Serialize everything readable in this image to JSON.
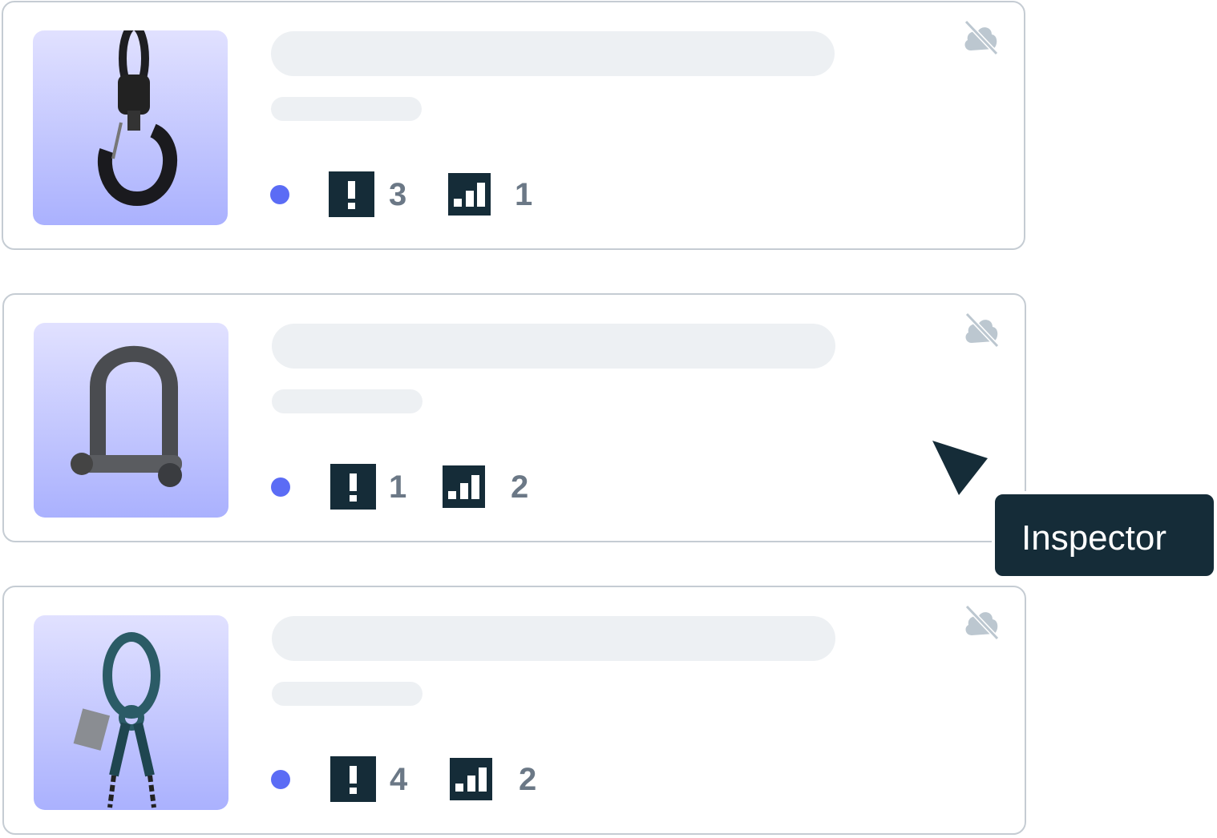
{
  "colors": {
    "status_dot": "#5b6cf5",
    "icon_bg": "#152c38",
    "count_text": "#6b7886",
    "skeleton": "#edf0f3"
  },
  "cards": [
    {
      "product": "hook",
      "status_icon": "status-dot",
      "alerts": "3",
      "signal": "1",
      "sync_icon": "cloud-off-icon"
    },
    {
      "product": "shackle",
      "status_icon": "status-dot",
      "alerts": "1",
      "signal": "2",
      "sync_icon": "cloud-off-icon"
    },
    {
      "product": "master-link",
      "status_icon": "status-dot",
      "alerts": "4",
      "signal": "2",
      "sync_icon": "cloud-off-icon"
    }
  ],
  "tooltip": {
    "label": "Inspector"
  }
}
